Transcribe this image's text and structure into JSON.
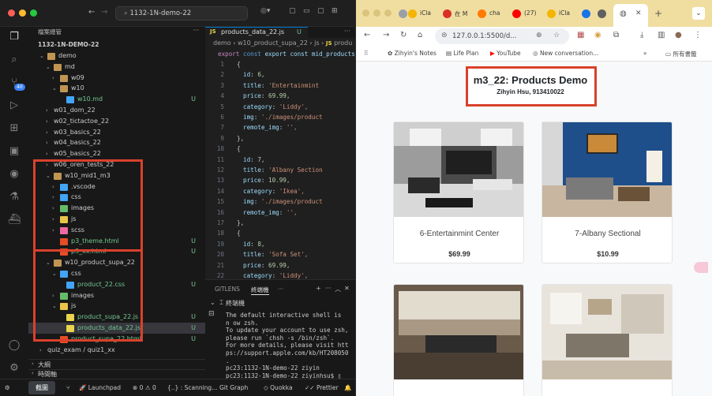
{
  "vscode": {
    "command_center": "1132-1N-demo-22",
    "explorer_title": "檔案總管",
    "root": "1132-1N-DEMO-22",
    "tree": [
      {
        "label": "demo",
        "chev": "down",
        "icon": "folder",
        "depth": 1
      },
      {
        "label": "md",
        "chev": "down",
        "icon": "folder",
        "depth": 2
      },
      {
        "label": "w09",
        "chev": "right",
        "icon": "folder",
        "depth": 3
      },
      {
        "label": "w10",
        "chev": "down",
        "icon": "folder",
        "depth": 3
      },
      {
        "label": "w10.md",
        "chev": "",
        "icon": "md",
        "depth": 4,
        "status": "U"
      },
      {
        "label": "w01_dom_22",
        "chev": "right",
        "icon": "",
        "depth": 2
      },
      {
        "label": "w02_tictactoe_22",
        "chev": "right",
        "icon": "",
        "depth": 2
      },
      {
        "label": "w03_basics_22",
        "chev": "right",
        "icon": "",
        "depth": 2
      },
      {
        "label": "w04_basics_22",
        "chev": "right",
        "icon": "",
        "depth": 2
      },
      {
        "label": "w05_basics_22",
        "chev": "right",
        "icon": "",
        "depth": 2
      },
      {
        "label": "w06_oren_tests_22",
        "chev": "right",
        "icon": "",
        "depth": 2
      },
      {
        "label": "w10_mid1_m3",
        "chev": "down",
        "icon": "folder",
        "depth": 2
      },
      {
        "label": ".vscode",
        "chev": "right",
        "icon": "folder-blue",
        "depth": 3
      },
      {
        "label": "css",
        "chev": "right",
        "icon": "folder-blue",
        "depth": 3
      },
      {
        "label": "images",
        "chev": "right",
        "icon": "folder-green",
        "depth": 3
      },
      {
        "label": "js",
        "chev": "right",
        "icon": "folder-yellow",
        "depth": 3
      },
      {
        "label": "scss",
        "chev": "right",
        "icon": "folder-pink",
        "depth": 3
      },
      {
        "label": "p3_theme.html",
        "chev": "",
        "icon": "html",
        "depth": 3,
        "status": "U"
      },
      {
        "label": "p3_xx.html",
        "chev": "",
        "icon": "html",
        "depth": 3,
        "status": "U"
      },
      {
        "label": "w10_product_supa_22",
        "chev": "down",
        "icon": "folder",
        "depth": 2
      },
      {
        "label": "css",
        "chev": "down",
        "icon": "folder-blue",
        "depth": 3
      },
      {
        "label": "product_22.css",
        "chev": "",
        "icon": "css",
        "depth": 4,
        "status": "U"
      },
      {
        "label": "images",
        "chev": "right",
        "icon": "folder-green",
        "depth": 3
      },
      {
        "label": "js",
        "chev": "down",
        "icon": "folder-yellow",
        "depth": 3
      },
      {
        "label": "product_supa_22.js",
        "chev": "",
        "icon": "js",
        "depth": 4,
        "status": "U"
      },
      {
        "label": "products_data_22.js",
        "chev": "",
        "icon": "js",
        "depth": 4,
        "status": "U",
        "selected": true
      },
      {
        "label": "product_supa_22.html",
        "chev": "",
        "icon": "html",
        "depth": 3,
        "status": "U"
      },
      {
        "label": "quiz_exam / quiz1_xx",
        "chev": "right",
        "icon": "",
        "depth": 1
      }
    ],
    "outline": "大綱",
    "timeline": "時間軸",
    "tab_label": "products_data_22.js",
    "tab_status": "U",
    "breadcrumb": [
      "demo",
      "w10_product_supa_22",
      "js",
      "produ"
    ],
    "code_first": "export const mid_products_",
    "code": [
      {
        "n": "1",
        "t": "{"
      },
      {
        "n": "2",
        "t": "id",
        "v": "6,",
        "vt": "num"
      },
      {
        "n": "3",
        "t": "title",
        "v": "'Entertainmint",
        "vt": "str"
      },
      {
        "n": "4",
        "t": "price",
        "v": "69.99,",
        "vt": "num"
      },
      {
        "n": "5",
        "t": "category",
        "v": "'Liddy',",
        "vt": "str"
      },
      {
        "n": "6",
        "t": "img",
        "v": "'./images/product",
        "vt": "str"
      },
      {
        "n": "7",
        "t": "remote_img",
        "v": "'',",
        "vt": "str"
      },
      {
        "n": "9",
        "t": "},"
      },
      {
        "n": "10",
        "t": "{"
      },
      {
        "n": "11",
        "t": "id",
        "v": "7,",
        "vt": "num"
      },
      {
        "n": "12",
        "t": "title",
        "v": "'Albany Section",
        "vt": "str"
      },
      {
        "n": "13",
        "t": "price",
        "v": "10.99,",
        "vt": "num"
      },
      {
        "n": "14",
        "t": "category",
        "v": "'Ikea',",
        "vt": "str"
      },
      {
        "n": "15",
        "t": "img",
        "v": "'./images/product",
        "vt": "str"
      },
      {
        "n": "16",
        "t": "remote_img",
        "v": "'',",
        "vt": "str"
      },
      {
        "n": "17",
        "t": "},"
      },
      {
        "n": "18",
        "t": "{"
      },
      {
        "n": "19",
        "t": "id",
        "v": "8,",
        "vt": "num"
      },
      {
        "n": "20",
        "t": "title",
        "v": "'Sofa Set',",
        "vt": "str"
      },
      {
        "n": "21",
        "t": "price",
        "v": "69.99,",
        "vt": "num"
      },
      {
        "n": "22",
        "t": "category",
        "v": "'Liddy',",
        "vt": "str"
      },
      {
        "n": "23",
        "t": "img",
        "v": "'./images/product",
        "vt": "str"
      },
      {
        "n": "24",
        "t": "remote_img",
        "v": "'',",
        "vt": "str"
      },
      {
        "n": "25",
        "t": "},"
      },
      {
        "n": "26",
        "t": "{"
      }
    ],
    "terminal_tabs": [
      "GITLENS",
      "終端機",
      "···"
    ],
    "terminal_title": "終端機",
    "terminal_lines": [
      "The default interactive shell is",
      "n ow zsh.",
      "To update your account to use zsh,",
      " please run `chsh -s /bin/zsh`.",
      "For more details, please visit htt",
      "ps://support.apple.com/kb/HT208050",
      ".",
      "pc23:1132-1N-demo-22 ziyin",
      "pc23:1132-1N-demo-22 ziyinhsu$ ▯"
    ],
    "status": {
      "errors": "0",
      "warnings": "0",
      "launchpad": "Launchpad",
      "scanning": "{..} : Scanning...",
      "gitgraph": "Git Graph",
      "quokka": "Quokka",
      "prettier": "Prettier",
      "sidebar_badge": "40",
      "tooltip": "截圖"
    }
  },
  "browser": {
    "tabs": [
      {
        "label": "",
        "fav": "#9aa0a6"
      },
      {
        "label": "iCla",
        "fav": "#f4b400"
      },
      {
        "label": "在 M",
        "fav": "#d93025"
      },
      {
        "label": "cha",
        "fav": "#ff7a00"
      },
      {
        "label": "(27)",
        "fav": "#ff0000"
      },
      {
        "label": "iCla",
        "fav": "#f4b400"
      },
      {
        "label": "",
        "fav": "#1a73e8"
      },
      {
        "label": "",
        "fav": "#606060"
      }
    ],
    "url": "127.0.0.1:5500/d...",
    "bookmarks": [
      "Zihyin's Notes",
      "Life Plan",
      "YouTube",
      "New conversation...",
      "»",
      "所有書籤"
    ],
    "page_title": "m3_22: Products Demo",
    "page_subtitle": "Zihyin Hsu, 913410022",
    "products": [
      {
        "name": "6-Entertainmint Center",
        "price": "$69.99"
      },
      {
        "name": "7-Albany Sectional",
        "price": "$10.99"
      },
      {
        "name": "",
        "price": ""
      },
      {
        "name": "",
        "price": ""
      }
    ]
  }
}
